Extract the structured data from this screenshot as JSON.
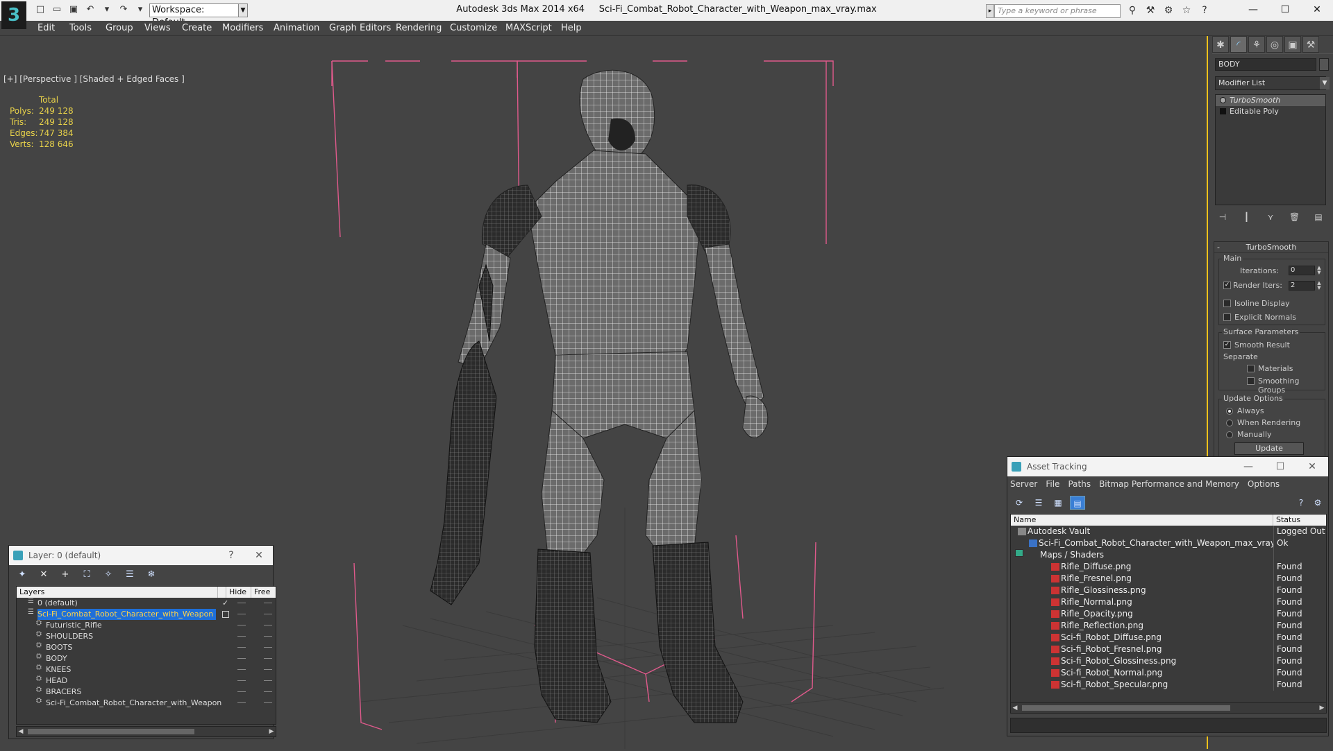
{
  "titlebar": {
    "workspace": "Workspace: Default",
    "app": "Autodesk 3ds Max  2014 x64",
    "file": "Sci-Fi_Combat_Robot_Character_with_Weapon_max_vray.max",
    "search_placeholder": "Type a keyword or phrase"
  },
  "menu": [
    "Edit",
    "Tools",
    "Group",
    "Views",
    "Create",
    "Modifiers",
    "Animation",
    "Graph Editors",
    "Rendering",
    "Customize",
    "MAXScript",
    "Help"
  ],
  "viewport": {
    "label": "[+] [Perspective ] [Shaded + Edged Faces ]",
    "stats_header": "Total",
    "stats": [
      {
        "label": "Polys:",
        "value": "249 128"
      },
      {
        "label": "Tris:",
        "value": "249 128"
      },
      {
        "label": "Edges:",
        "value": "747 384"
      },
      {
        "label": "Verts:",
        "value": "128 646"
      }
    ]
  },
  "command_panel": {
    "object_name": "BODY",
    "modifier_list": "Modifier List",
    "stack": [
      "TurboSmooth",
      "Editable Poly"
    ],
    "rollout_title": "TurboSmooth",
    "main_label": "Main",
    "iterations_label": "Iterations:",
    "iterations_value": "0",
    "render_iters_label": "Render Iters:",
    "render_iters_value": "2",
    "isoline": "Isoline Display",
    "explicit_normals": "Explicit Normals",
    "surface_params": "Surface Parameters",
    "smooth_result": "Smooth Result",
    "separate": "Separate",
    "materials": "Materials",
    "smoothing_groups": "Smoothing Groups",
    "update_options": "Update Options",
    "always": "Always",
    "when_rendering": "When Rendering",
    "manually": "Manually",
    "update_btn": "Update"
  },
  "layer_panel": {
    "title": "Layer: 0 (default)",
    "help": "?",
    "col_layers": "Layers",
    "col_hide": "Hide",
    "col_freeze": "Free",
    "rows": [
      {
        "name": "0 (default)",
        "indent": 1,
        "check": "✓"
      },
      {
        "name": "Sci-Fi_Combat_Robot_Character_with_Weapon",
        "indent": 1,
        "selected": true
      },
      {
        "name": "Futuristic_Rifle",
        "indent": 2
      },
      {
        "name": "SHOULDERS",
        "indent": 2
      },
      {
        "name": "BOOTS",
        "indent": 2
      },
      {
        "name": "BODY",
        "indent": 2
      },
      {
        "name": "KNEES",
        "indent": 2
      },
      {
        "name": "HEAD",
        "indent": 2
      },
      {
        "name": "BRACERS",
        "indent": 2
      },
      {
        "name": "Sci-Fi_Combat_Robot_Character_with_Weapon",
        "indent": 2
      }
    ]
  },
  "asset_panel": {
    "title": "Asset Tracking",
    "menu": [
      "Server",
      "File",
      "Paths",
      "Bitmap Performance and Memory",
      "Options"
    ],
    "col_name": "Name",
    "col_status": "Status",
    "rows": [
      {
        "name": "Autodesk Vault",
        "status": "Logged Out",
        "indent": 1,
        "icon": "vault"
      },
      {
        "name": "Sci-Fi_Combat_Robot_Character_with_Weapon_max_vray.max",
        "status": "Ok",
        "indent": 2,
        "icon": "max"
      },
      {
        "name": "Maps / Shaders",
        "status": "",
        "indent": 3,
        "icon": "grp"
      },
      {
        "name": "Rifle_Diffuse.png",
        "status": "Found",
        "indent": 4,
        "icon": "png"
      },
      {
        "name": "Rifle_Fresnel.png",
        "status": "Found",
        "indent": 4,
        "icon": "png"
      },
      {
        "name": "Rifle_Glossiness.png",
        "status": "Found",
        "indent": 4,
        "icon": "png"
      },
      {
        "name": "Rifle_Normal.png",
        "status": "Found",
        "indent": 4,
        "icon": "png"
      },
      {
        "name": "Rifle_Opacity.png",
        "status": "Found",
        "indent": 4,
        "icon": "png"
      },
      {
        "name": "Rifle_Reflection.png",
        "status": "Found",
        "indent": 4,
        "icon": "png"
      },
      {
        "name": "Sci-fi_Robot_Diffuse.png",
        "status": "Found",
        "indent": 4,
        "icon": "png"
      },
      {
        "name": "Sci-fi_Robot_Fresnel.png",
        "status": "Found",
        "indent": 4,
        "icon": "png"
      },
      {
        "name": "Sci-fi_Robot_Glossiness.png",
        "status": "Found",
        "indent": 4,
        "icon": "png"
      },
      {
        "name": "Sci-fi_Robot_Normal.png",
        "status": "Found",
        "indent": 4,
        "icon": "png"
      },
      {
        "name": "Sci-fi_Robot_Specular.png",
        "status": "Found",
        "indent": 4,
        "icon": "png"
      }
    ]
  },
  "colors": {
    "accent": "#f0c21a",
    "selection": "#1e6fd9",
    "stats": "#e8d24a",
    "bbox": "#e05a8c"
  }
}
